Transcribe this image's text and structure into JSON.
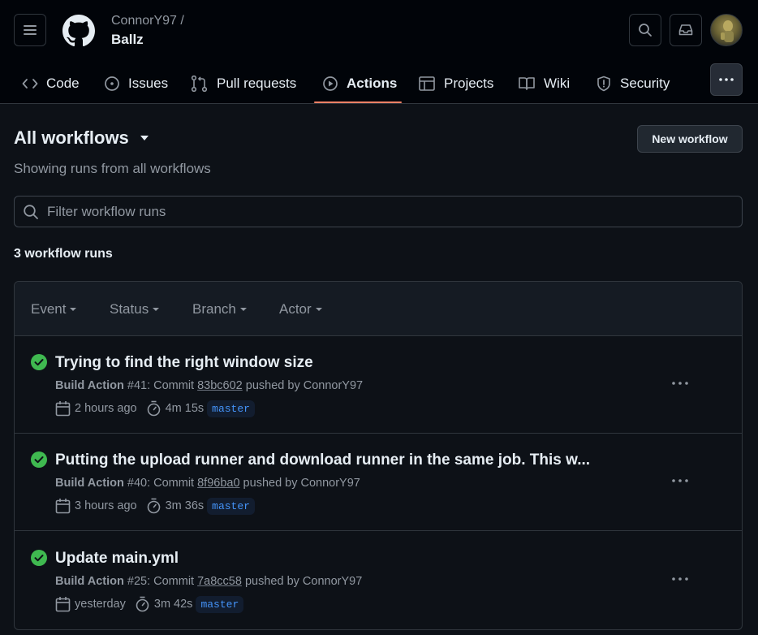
{
  "header": {
    "owner": "ConnorY97 /",
    "repo": "Ballz"
  },
  "tabs": [
    {
      "label": "Code",
      "icon": "code-icon"
    },
    {
      "label": "Issues",
      "icon": "issue-icon"
    },
    {
      "label": "Pull requests",
      "icon": "pull-request-icon"
    },
    {
      "label": "Actions",
      "icon": "play-icon",
      "active": true
    },
    {
      "label": "Projects",
      "icon": "table-icon"
    },
    {
      "label": "Wiki",
      "icon": "book-icon"
    },
    {
      "label": "Security",
      "icon": "shield-icon"
    }
  ],
  "page": {
    "title": "All workflows",
    "subtitle": "Showing runs from all workflows",
    "new_workflow_label": "New workflow",
    "filter_placeholder": "Filter workflow runs",
    "run_count": "3 workflow runs"
  },
  "filters": [
    "Event",
    "Status",
    "Branch",
    "Actor"
  ],
  "runs": [
    {
      "title": "Trying to find the right window size",
      "workflow": "Build Action",
      "run_number": "#41",
      "commit_prefix": ": Commit ",
      "sha": "83bc602",
      "pushed_by": " pushed by ConnorY97",
      "when": "2 hours ago",
      "duration": "4m 15s",
      "branch": "master",
      "status": "success"
    },
    {
      "title": "Putting the upload runner and download runner in the same job. This w...",
      "workflow": "Build Action",
      "run_number": "#40",
      "commit_prefix": ": Commit ",
      "sha": "8f96ba0",
      "pushed_by": " pushed by ConnorY97",
      "when": "3 hours ago",
      "duration": "3m 36s",
      "branch": "master",
      "status": "success"
    },
    {
      "title": "Update main.yml",
      "workflow": "Build Action",
      "run_number": "#25",
      "commit_prefix": ": Commit ",
      "sha": "7a8cc58",
      "pushed_by": " pushed by ConnorY97",
      "when": "yesterday",
      "duration": "3m 42s",
      "branch": "master",
      "status": "success"
    }
  ],
  "colors": {
    "accent_underline": "#f78166",
    "success": "#3fb950",
    "branch": "#4493f8"
  }
}
